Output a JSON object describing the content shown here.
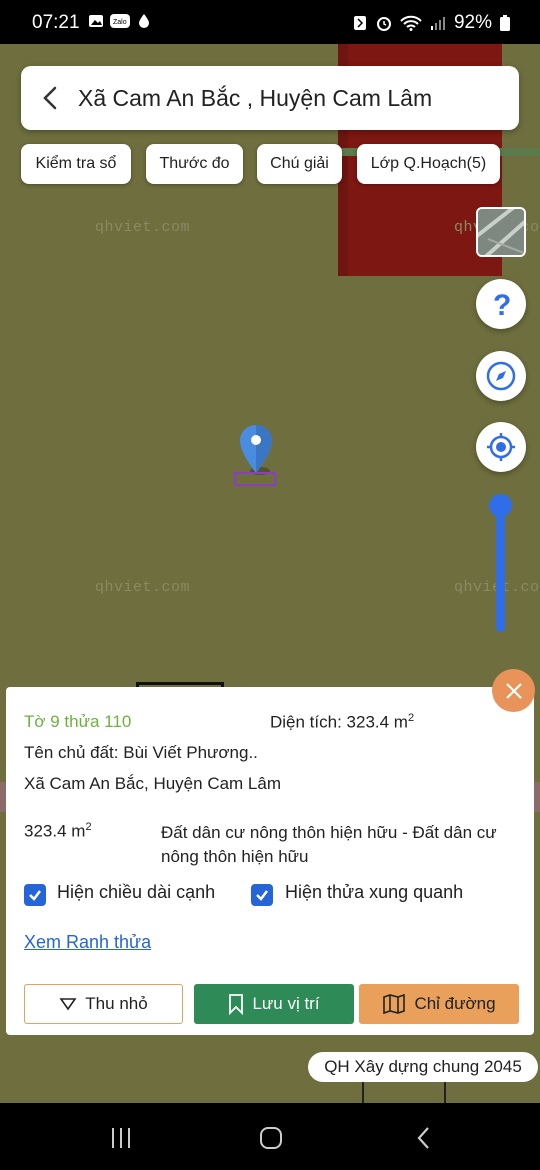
{
  "status_bar": {
    "time": "07:21",
    "left_icons": [
      "gallery-icon",
      "zalo-icon",
      "water-drop-icon"
    ],
    "right_icons": [
      "nfc-icon",
      "alarm-icon",
      "wifi-icon",
      "signal-icon",
      "battery-icon"
    ],
    "battery": "92%"
  },
  "header": {
    "title": "Xã Cam An Bắc , Huyện Cam Lâm"
  },
  "chips": [
    {
      "label": "Kiểm tra sổ"
    },
    {
      "label": "Thước đo"
    },
    {
      "label": "Chú giải"
    },
    {
      "label": "Lớp Q.Hoạch(5)"
    }
  ],
  "map": {
    "watermark": "qhviet.com",
    "background_color": "#6e6e3e",
    "zone_color": "#7d1712",
    "zoom_level": 1.0
  },
  "map_controls": [
    "satellite-layer-button",
    "help-icon",
    "compass-icon",
    "my-location-icon"
  ],
  "panel": {
    "parcel_id": "Tờ 9 thửa 110",
    "area_label": "Diện tích: 323.4 m",
    "area_unit_sup": "2",
    "owner": "Tên chủ đất: Bùi Viết Phương..",
    "location": "Xã Cam An Bắc, Huyện Cam Lâm",
    "land_area": "323.4 m",
    "land_area_sup": "2",
    "land_use": "Đất dân cư nông thôn hiện hữu - Đất dân cư nông thôn hiện hữu",
    "checkbox_edges": {
      "label": "Hiện chiều dài cạnh",
      "checked": true
    },
    "checkbox_neighbors": {
      "label": "Hiện thửa xung quanh",
      "checked": true
    },
    "view_boundary_link": "Xem Ranh thửa",
    "buttons": {
      "collapse": "Thu nhỏ",
      "save": "Lưu vị trí",
      "directions": "Chỉ đường"
    },
    "colors": {
      "accent": "#2565d8",
      "save": "#2e8b57",
      "directions": "#e8a05a",
      "close": "#e8935a",
      "parcel_id": "#6bb33a"
    }
  },
  "plan_badge": "QH Xây dựng chung 2045"
}
